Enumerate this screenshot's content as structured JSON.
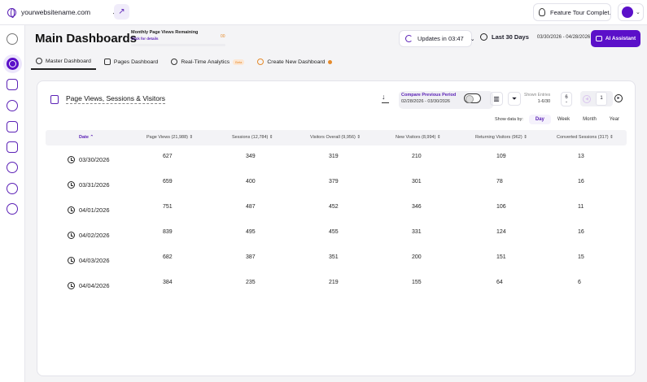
{
  "topbar": {
    "site": "yourwebsitename.com",
    "tour": "Feature Tour Complet..."
  },
  "header": {
    "title": "Main Dashboards",
    "quota_label": "Monthly Page Views Remaining",
    "quota_link": "Click for details",
    "quota_value": "00",
    "updates": "Updates in 03:47",
    "range_label": "Last 30 Days",
    "range_dates": "03/30/2026 - 04/28/2026",
    "ai_button": "AI Assistant"
  },
  "tabs": [
    {
      "label": "Master Dashboard"
    },
    {
      "label": "Pages Dashboard"
    },
    {
      "label": "Real-Time Analytics",
      "badge": "Beta"
    },
    {
      "label": "Create New Dashboard"
    }
  ],
  "card": {
    "title": "Page Views, Sessions & Visitors",
    "compare_label": "Compare Previous Period",
    "compare_dates": "02/28/2026 - 03/30/2026",
    "entries_label": "Shown Entries",
    "entries_range": "1-6/30",
    "page_size": "6",
    "current_page": "1",
    "show_by_label": "Show data by:",
    "periods": [
      "Day",
      "Week",
      "Month",
      "Year"
    ]
  },
  "table": {
    "columns": [
      "Date",
      "Page Views (21,988)",
      "Sessions (12,784)",
      "Visitors Overall (9,956)",
      "New Visitors (8,994)",
      "Returning Visitors (962)",
      "Converted Sessions (317)"
    ],
    "rows": [
      [
        "03/30/2026",
        "627",
        "349",
        "319",
        "210",
        "109",
        "13"
      ],
      [
        "03/31/2026",
        "659",
        "400",
        "379",
        "301",
        "78",
        "16"
      ],
      [
        "04/01/2026",
        "751",
        "487",
        "452",
        "346",
        "106",
        "11"
      ],
      [
        "04/02/2026",
        "839",
        "495",
        "455",
        "331",
        "124",
        "16"
      ],
      [
        "04/03/2026",
        "682",
        "387",
        "351",
        "200",
        "151",
        "15"
      ],
      [
        "04/04/2026",
        "384",
        "235",
        "219",
        "155",
        "64",
        "6"
      ]
    ]
  }
}
